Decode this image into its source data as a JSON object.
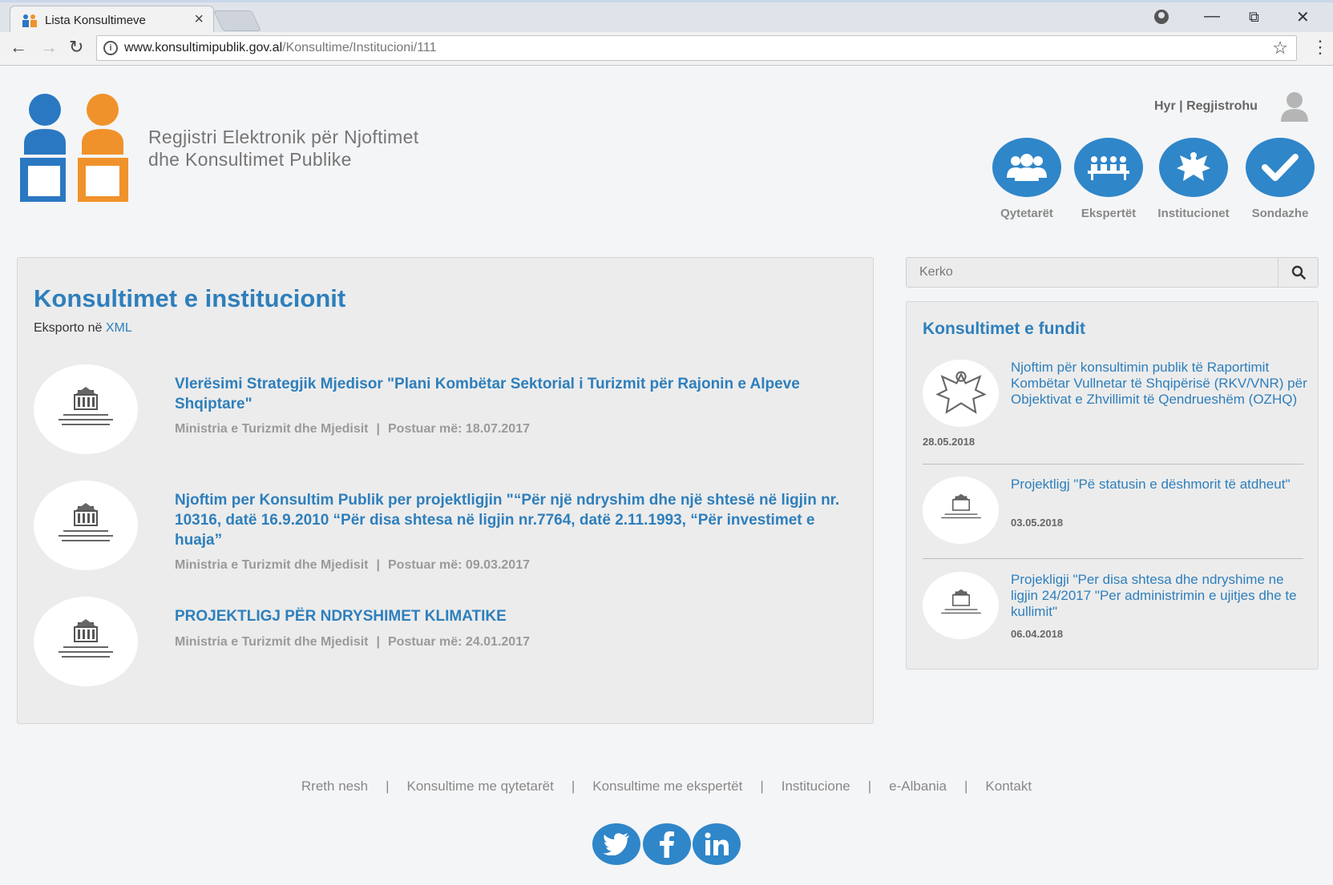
{
  "browser": {
    "tab_title": "Lista Konsultimeve",
    "tab_close": "×",
    "url_host": "www.konsultimipublik.gov.al",
    "url_path": "/Konsultime/Institucioni/111"
  },
  "header": {
    "site_title_line1": "Regjistri Elektronik për Njoftimet",
    "site_title_line2": "dhe Konsultimet Publike",
    "login": "Hyr",
    "login_sep": " | ",
    "register": "Regjistrohu",
    "categories": [
      {
        "label": "Qytetarët",
        "icon": "citizens-icon"
      },
      {
        "label": "Ekspertët",
        "icon": "experts-icon"
      },
      {
        "label": "Institucionet",
        "icon": "institutions-eagle-icon"
      },
      {
        "label": "Sondazhe",
        "icon": "checkmark-icon"
      }
    ]
  },
  "main": {
    "title": "Konsultimet e institucionit",
    "export_prefix": "Eksporto në ",
    "export_link": "XML",
    "items": [
      {
        "title": "Vlerësimi Strategjik Mjedisor \"Plani Kombëtar Sektorial i Turizmit për Rajonin e Alpeve Shqiptare\"",
        "institution": "Ministria e Turizmit dhe Mjedisit",
        "posted": "Postuar më: 18.07.2017"
      },
      {
        "title": "Njoftim per Konsultim Publik per projektligjin \"“Për një ndryshim dhe një shtesë në ligjin nr. 10316, datë 16.9.2010 “Për disa shtesa në ligjin nr.7764, datë 2.11.1993, “Për investimet e huaja”",
        "institution": "Ministria e Turizmit dhe Mjedisit",
        "posted": "Postuar më: 09.03.2017"
      },
      {
        "title": "PROJEKTLIGJ PËR NDRYSHIMET KLIMATIKE",
        "institution": "Ministria e Turizmit dhe Mjedisit",
        "posted": "Postuar më: 24.01.2017"
      }
    ],
    "meta_sep": "|"
  },
  "sidebar": {
    "search_placeholder": "Kerko",
    "title": "Konsultimet e fundit",
    "recent": [
      {
        "title": "Njoftim për konsultimin publik të Raportimit Kombëtar Vullnetar të Shqipërisë (RKV/VNR) për Objektivat e Zhvillimit të Qendrueshëm (OZHQ)",
        "date": "28.05.2018"
      },
      {
        "title": "Projektligj \"Pë statusin e dëshmorit të atdheut\"",
        "date": "03.05.2018"
      },
      {
        "title": "Projekligji \"Per disa shtesa dhe ndryshime ne ligjin 24/2017 \"Per administrimin e ujitjes dhe te kullimit\"",
        "date": "06.04.2018"
      }
    ]
  },
  "footer": {
    "links": [
      "Rreth nesh",
      "Konsultime me qytetarët",
      "Konsultime me ekspertët",
      "Institucione",
      "e-Albania",
      "Kontakt"
    ],
    "bar": "|",
    "social": [
      "twitter-icon",
      "facebook-icon",
      "linkedin-icon"
    ]
  },
  "colors": {
    "brand_blue": "#2f86c9",
    "link_blue": "#2e7fbc",
    "logo_orange": "#f0922b",
    "logo_blue": "#2b78c2"
  }
}
